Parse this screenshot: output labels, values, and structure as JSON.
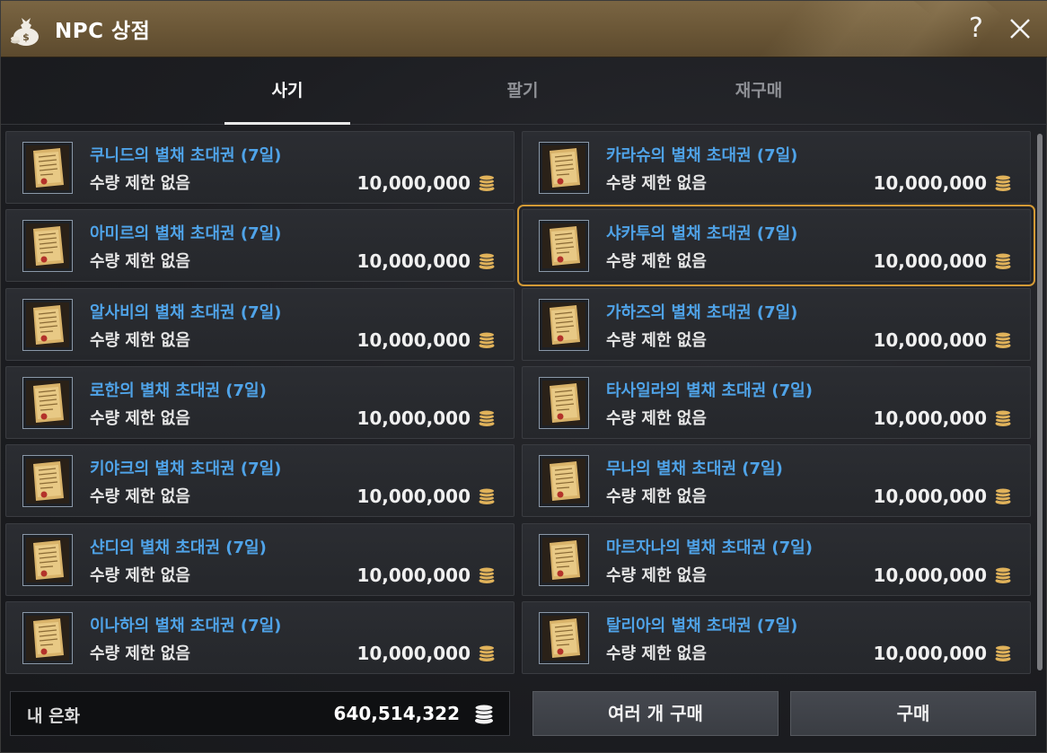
{
  "window": {
    "title": "NPC 상점",
    "help_label": "?"
  },
  "tabs": [
    {
      "label": "사기",
      "active": true
    },
    {
      "label": "팔기",
      "active": false
    },
    {
      "label": "재구매",
      "active": false
    }
  ],
  "items": [
    {
      "name": "쿠니드의 별채 초대권 (7일)",
      "limit": "수량 제한 없음",
      "price": "10,000,000"
    },
    {
      "name": "카라슈의 별채 초대권 (7일)",
      "limit": "수량 제한 없음",
      "price": "10,000,000"
    },
    {
      "name": "아미르의 별채 초대권 (7일)",
      "limit": "수량 제한 없음",
      "price": "10,000,000"
    },
    {
      "name": "샤카투의 별채 초대권 (7일)",
      "limit": "수량 제한 없음",
      "price": "10,000,000",
      "selected": true
    },
    {
      "name": "알사비의 별채 초대권 (7일)",
      "limit": "수량 제한 없음",
      "price": "10,000,000"
    },
    {
      "name": "가하즈의 별채 초대권 (7일)",
      "limit": "수량 제한 없음",
      "price": "10,000,000"
    },
    {
      "name": "로한의 별채 초대권 (7일)",
      "limit": "수량 제한 없음",
      "price": "10,000,000"
    },
    {
      "name": "타사일라의 별채 초대권 (7일)",
      "limit": "수량 제한 없음",
      "price": "10,000,000"
    },
    {
      "name": "키야크의 별채 초대권 (7일)",
      "limit": "수량 제한 없음",
      "price": "10,000,000"
    },
    {
      "name": "무나의 별채 초대권 (7일)",
      "limit": "수량 제한 없음",
      "price": "10,000,000"
    },
    {
      "name": "샨디의 별채 초대권 (7일)",
      "limit": "수량 제한 없음",
      "price": "10,000,000"
    },
    {
      "name": "마르자나의 별채 초대권 (7일)",
      "limit": "수량 제한 없음",
      "price": "10,000,000"
    },
    {
      "name": "이나하의 별채 초대권 (7일)",
      "limit": "수량 제한 없음",
      "price": "10,000,000"
    },
    {
      "name": "탈리아의 별채 초대권 (7일)",
      "limit": "수량 제한 없음",
      "price": "10,000,000"
    }
  ],
  "wallet": {
    "label": "내 은화",
    "amount": "640,514,322"
  },
  "buttons": {
    "multi_buy": "여러 개 구매",
    "buy": "구매"
  },
  "colors": {
    "title_bar": "#6a5636",
    "item_name": "#4fa3e8",
    "selected_outline": "#d39a36",
    "coin": "#e0b25a"
  },
  "icons": {
    "title": "money-bag-icon",
    "item": "scroll-icon",
    "currency": "silver-coin-stack-icon",
    "close": "close-icon"
  }
}
